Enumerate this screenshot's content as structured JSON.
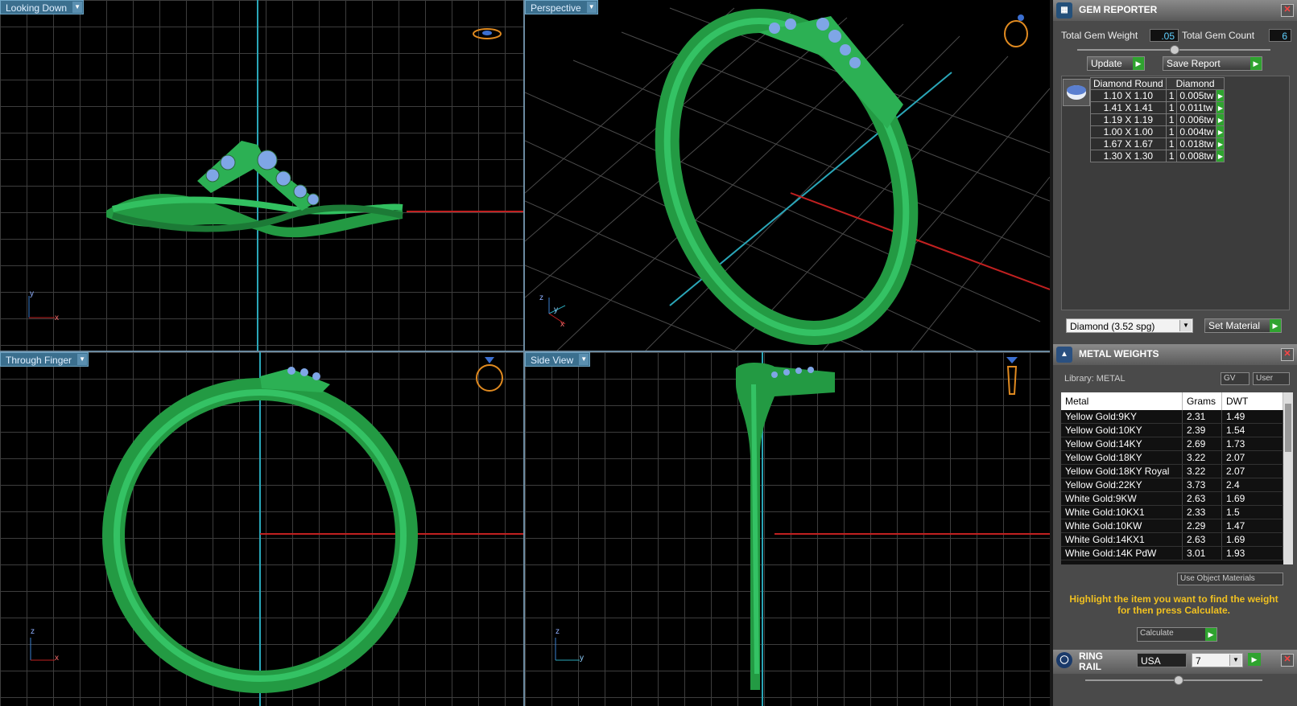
{
  "viewports": {
    "top_left": {
      "label": "Looking Down"
    },
    "top_right": {
      "label": "Perspective"
    },
    "bottom_left": {
      "label": "Through Finger"
    },
    "bottom_right": {
      "label": "Side View"
    }
  },
  "axes": {
    "x": "x",
    "y": "y",
    "z": "z"
  },
  "gem_reporter": {
    "title": "GEM REPORTER",
    "total_weight_label": "Total Gem Weight",
    "total_weight_value": ".05",
    "total_count_label": "Total Gem Count",
    "total_count_value": "6",
    "update_label": "Update",
    "save_report_label": "Save Report",
    "columns": [
      "Diamond Round",
      "Diamond"
    ],
    "rows": [
      {
        "size": "1.10 X 1.10",
        "qty": "1",
        "weight": "0.005tw"
      },
      {
        "size": "1.41 X 1.41",
        "qty": "1",
        "weight": "0.011tw"
      },
      {
        "size": "1.19 X 1.19",
        "qty": "1",
        "weight": "0.006tw"
      },
      {
        "size": "1.00 X 1.00",
        "qty": "1",
        "weight": "0.004tw"
      },
      {
        "size": "1.67 X 1.67",
        "qty": "1",
        "weight": "0.018tw"
      },
      {
        "size": "1.30 X 1.30",
        "qty": "1",
        "weight": "0.008tw"
      }
    ],
    "material_select": "Diamond    (3.52 spg)",
    "set_material_label": "Set Material"
  },
  "metal_weights": {
    "title": "METAL WEIGHTS",
    "library_label": "Library: METAL",
    "gv_label": "GV",
    "user_label": "User",
    "columns": [
      "Metal",
      "Grams",
      "DWT"
    ],
    "rows": [
      {
        "metal": "Yellow Gold:9KY",
        "grams": "2.31",
        "dwt": "1.49"
      },
      {
        "metal": "Yellow Gold:10KY",
        "grams": "2.39",
        "dwt": "1.54"
      },
      {
        "metal": "Yellow Gold:14KY",
        "grams": "2.69",
        "dwt": "1.73"
      },
      {
        "metal": "Yellow Gold:18KY",
        "grams": "3.22",
        "dwt": "2.07"
      },
      {
        "metal": "Yellow Gold:18KY Royal",
        "grams": "3.22",
        "dwt": "2.07"
      },
      {
        "metal": "Yellow Gold:22KY",
        "grams": "3.73",
        "dwt": "2.4"
      },
      {
        "metal": "White Gold:9KW",
        "grams": "2.63",
        "dwt": "1.69"
      },
      {
        "metal": "White Gold:10KX1",
        "grams": "2.33",
        "dwt": "1.5"
      },
      {
        "metal": "White Gold:10KW",
        "grams": "2.29",
        "dwt": "1.47"
      },
      {
        "metal": "White Gold:14KX1",
        "grams": "2.63",
        "dwt": "1.69"
      },
      {
        "metal": "White Gold:14K PdW",
        "grams": "3.01",
        "dwt": "1.93"
      }
    ],
    "use_object_materials_label": "Use Object Materials",
    "hint": "Highlight the item you want to find the weight for then press Calculate.",
    "calculate_label": "Calculate"
  },
  "ring_rail": {
    "title": "RING RAIL",
    "standard": "USA",
    "size": "7"
  },
  "colors": {
    "ring": "#2a9a4a",
    "gem": "#7fa6e6",
    "accent": "#3b6f8e",
    "go": "#2fa32f"
  }
}
